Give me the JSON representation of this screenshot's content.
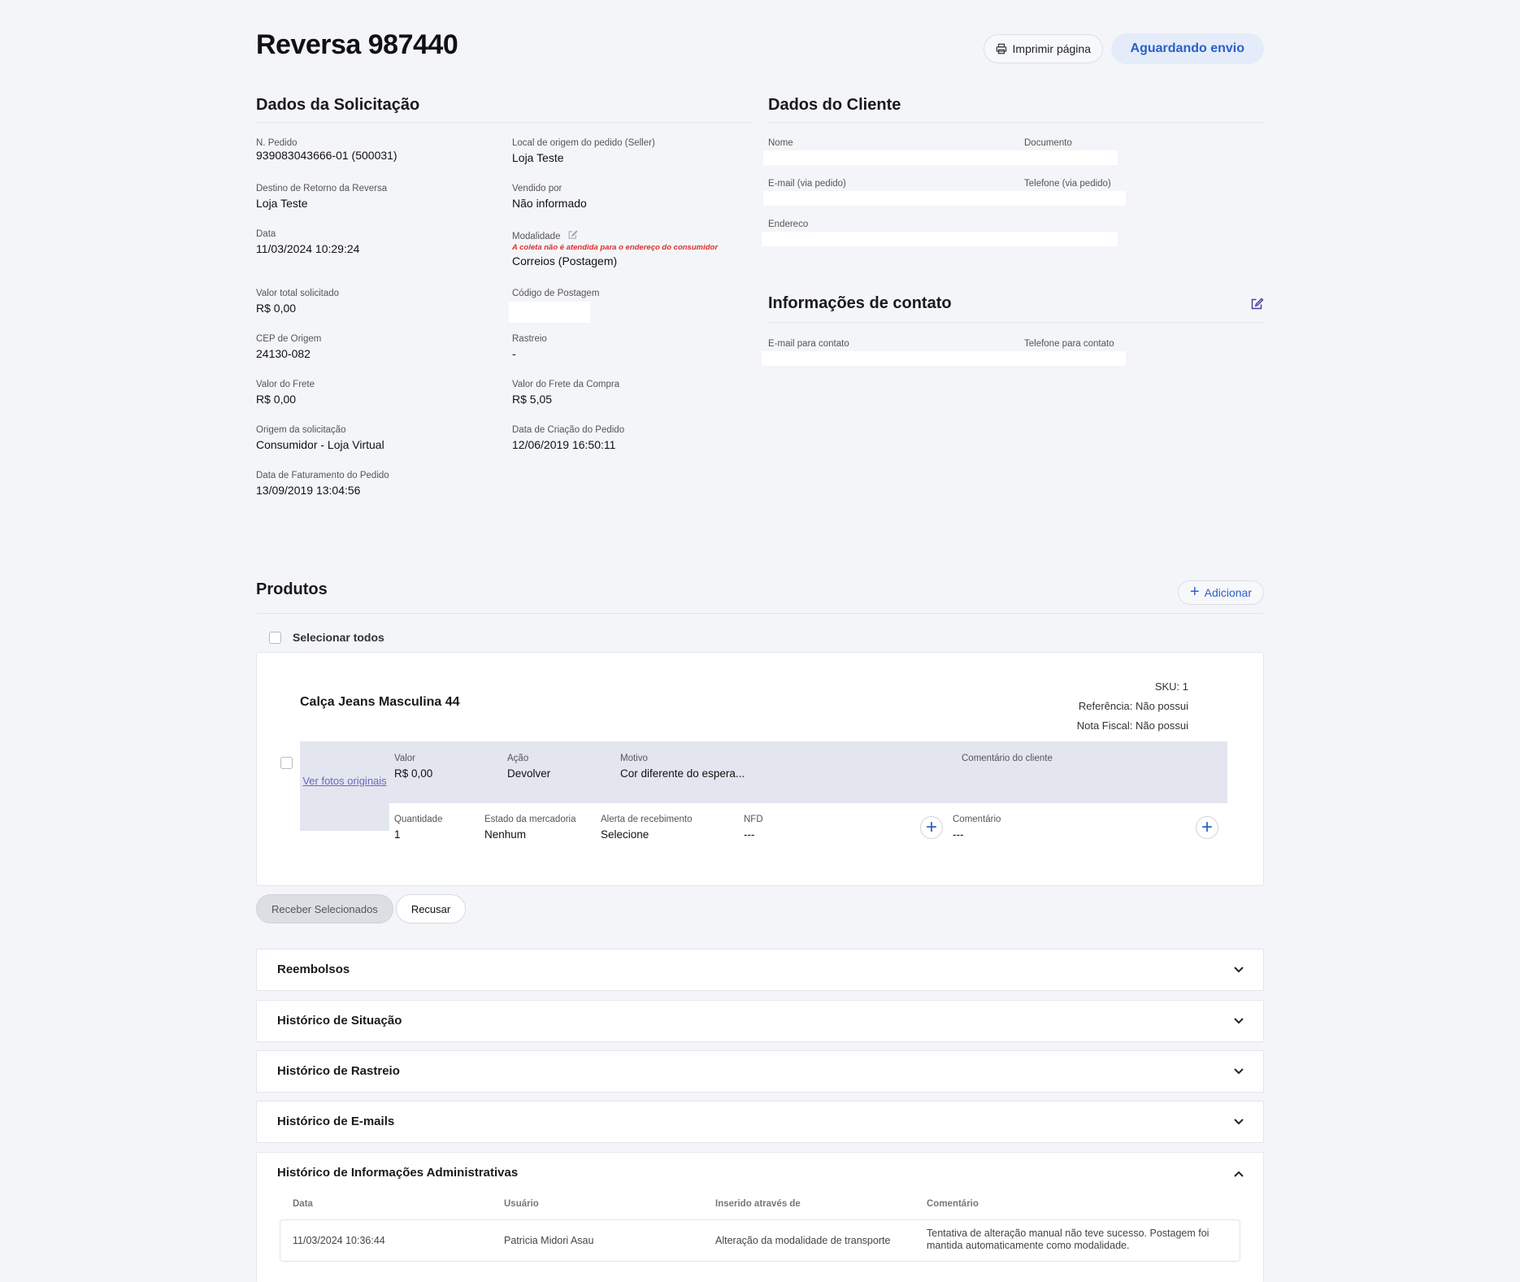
{
  "header": {
    "title": "Reversa 987440",
    "print_label": "Imprimir página",
    "status": "Aguardando envio"
  },
  "solicitacao": {
    "title": "Dados da Solicitação",
    "fields": {
      "pedido": {
        "label": "N. Pedido",
        "value": "939083043666-01 (500031)"
      },
      "local_origem": {
        "label": "Local de origem do pedido (Seller)",
        "value": "Loja Teste"
      },
      "destino": {
        "label": "Destino de Retorno da Reversa",
        "value": "Loja Teste"
      },
      "vendido_por": {
        "label": "Vendido por",
        "value": "Não informado"
      },
      "data": {
        "label": "Data",
        "value": "11/03/2024 10:29:24"
      },
      "modalidade": {
        "label": "Modalidade",
        "warning": "A coleta não é atendida para o endereço do consumidor",
        "value": "Correios (Postagem)"
      },
      "valor_total": {
        "label": "Valor total solicitado",
        "value": "R$ 0,00"
      },
      "codigo_postagem": {
        "label": "Código de Postagem",
        "value": ""
      },
      "cep": {
        "label": "CEP de Origem",
        "value": "24130-082"
      },
      "rastreio": {
        "label": "Rastreio",
        "value": "-"
      },
      "valor_frete": {
        "label": "Valor do Frete",
        "value": "R$ 0,00"
      },
      "valor_frete_compra": {
        "label": "Valor do Frete da Compra",
        "value": "R$ 5,05"
      },
      "origem": {
        "label": "Origem da solicitação",
        "value": "Consumidor - Loja Virtual"
      },
      "data_criacao": {
        "label": "Data de Criação do Pedido",
        "value": "12/06/2019 16:50:11"
      },
      "data_faturamento": {
        "label": "Data de Faturamento do Pedido",
        "value": "13/09/2019 13:04:56"
      }
    }
  },
  "cliente": {
    "title": "Dados do Cliente",
    "nome_label": "Nome",
    "documento_label": "Documento",
    "email_label": "E-mail (via pedido)",
    "telefone_label": "Telefone (via pedido)",
    "endereco_label": "Endereco"
  },
  "contato": {
    "title": "Informações de contato",
    "email_label": "E-mail para contato",
    "telefone_label": "Telefone para contato"
  },
  "produtos": {
    "title": "Produtos",
    "add_label": "Adicionar",
    "select_all_label": "Selecionar todos",
    "item": {
      "name": "Calça Jeans Masculina 44",
      "sku": "SKU: 1",
      "referencia": "Referência: Não possui",
      "nota_fiscal": "Nota Fiscal: Não possui",
      "photos_link": "Ver fotos originais",
      "valor_label": "Valor",
      "valor": "R$ 0,00",
      "acao_label": "Ação",
      "acao": "Devolver",
      "motivo_label": "Motivo",
      "motivo": "Cor diferente do espera...",
      "comentario_cliente_label": "Comentário do cliente",
      "quantidade_label": "Quantidade",
      "quantidade": "1",
      "estado_label": "Estado da mercadoria",
      "estado": "Nenhum",
      "alerta_label": "Alerta de recebimento",
      "alerta": "Selecione",
      "nfd_label": "NFD",
      "nfd": "---",
      "comentario_label": "Comentário",
      "comentario": "---"
    },
    "receber_label": "Receber Selecionados",
    "recusar_label": "Recusar"
  },
  "accordions": {
    "reembolsos": "Reembolsos",
    "situacao": "Histórico de Situação",
    "rastreio": "Histórico de Rastreio",
    "emails": "Histórico de E-mails",
    "admin": "Histórico de Informações Administrativas"
  },
  "admin_table": {
    "headers": {
      "data": "Data",
      "usuario": "Usuário",
      "inserido": "Inserido através de",
      "comentario": "Comentário"
    },
    "row": {
      "data": "11/03/2024 10:36:44",
      "usuario": "Patricia Midori Asau",
      "inserido": "Alteração da modalidade de transporte",
      "comentario": "Tentativa de alteração manual não teve sucesso. Postagem foi mantida automaticamente como modalidade."
    }
  },
  "colors": {
    "accent": "#2b5fc7",
    "warning": "#e0302f",
    "status_bg": "#e4ecfa"
  }
}
